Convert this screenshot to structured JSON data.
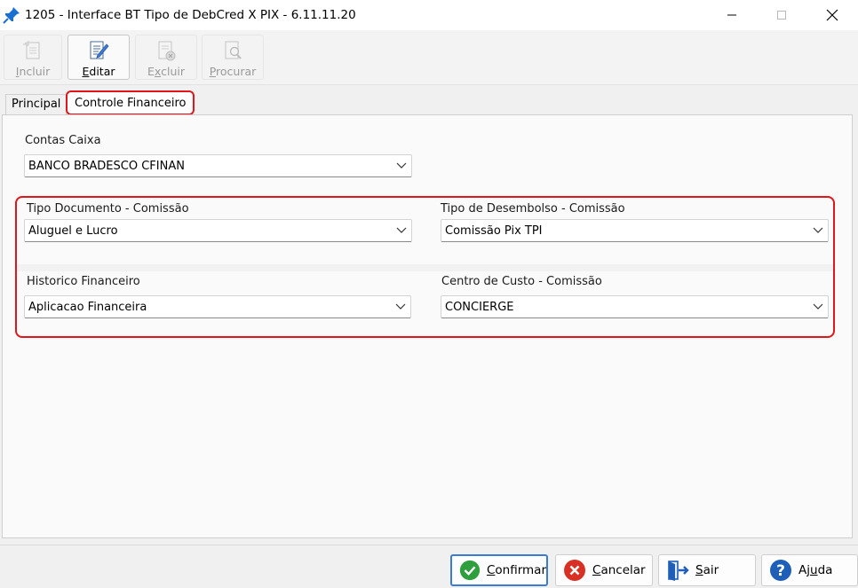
{
  "window": {
    "title": "1205 - Interface BT Tipo de DebCred X PIX - 6.11.11.20",
    "icon": "pushpin-icon"
  },
  "toolbar": {
    "incluir": {
      "pre": "",
      "key": "I",
      "post": "ncluir",
      "enabled": false
    },
    "editar": {
      "pre": "",
      "key": "E",
      "post": "ditar",
      "enabled": true
    },
    "excluir": {
      "pre": "E",
      "key": "x",
      "post": "cluir",
      "enabled": false
    },
    "procurar": {
      "pre": "",
      "key": "P",
      "post": "rocurar",
      "enabled": false
    }
  },
  "tabs": {
    "principal": "Principal",
    "controle_financeiro": "Controle Financeiro",
    "active": "controle_financeiro"
  },
  "form": {
    "contas_caixa": {
      "label": "Contas Caixa",
      "value": "BANCO BRADESCO CFINAN"
    },
    "tipo_documento": {
      "label": "Tipo Documento - Comissão",
      "value": "Aluguel e Lucro"
    },
    "tipo_desembolso": {
      "label": "Tipo de Desembolso - Comissão",
      "value": "Comissão Pix TPI"
    },
    "historico_financeiro": {
      "label": "Historico Financeiro",
      "value": "Aplicacao Financeira"
    },
    "centro_custo": {
      "label": "Centro de Custo - Comissão",
      "value": "CONCIERGE"
    }
  },
  "buttons": {
    "confirmar": {
      "key": "C",
      "rest": "onfirmar"
    },
    "cancelar": {
      "key": "C",
      "rest": "ancelar"
    },
    "sair": {
      "key": "S",
      "rest": "air"
    },
    "ajuda": {
      "pre": "Aj",
      "key": "u",
      "post": "da"
    }
  },
  "colors": {
    "highlight": "#e0161b",
    "confirm_green": "#2e9e3e",
    "cancel_red": "#d93025",
    "help_blue": "#1f5fb8"
  }
}
